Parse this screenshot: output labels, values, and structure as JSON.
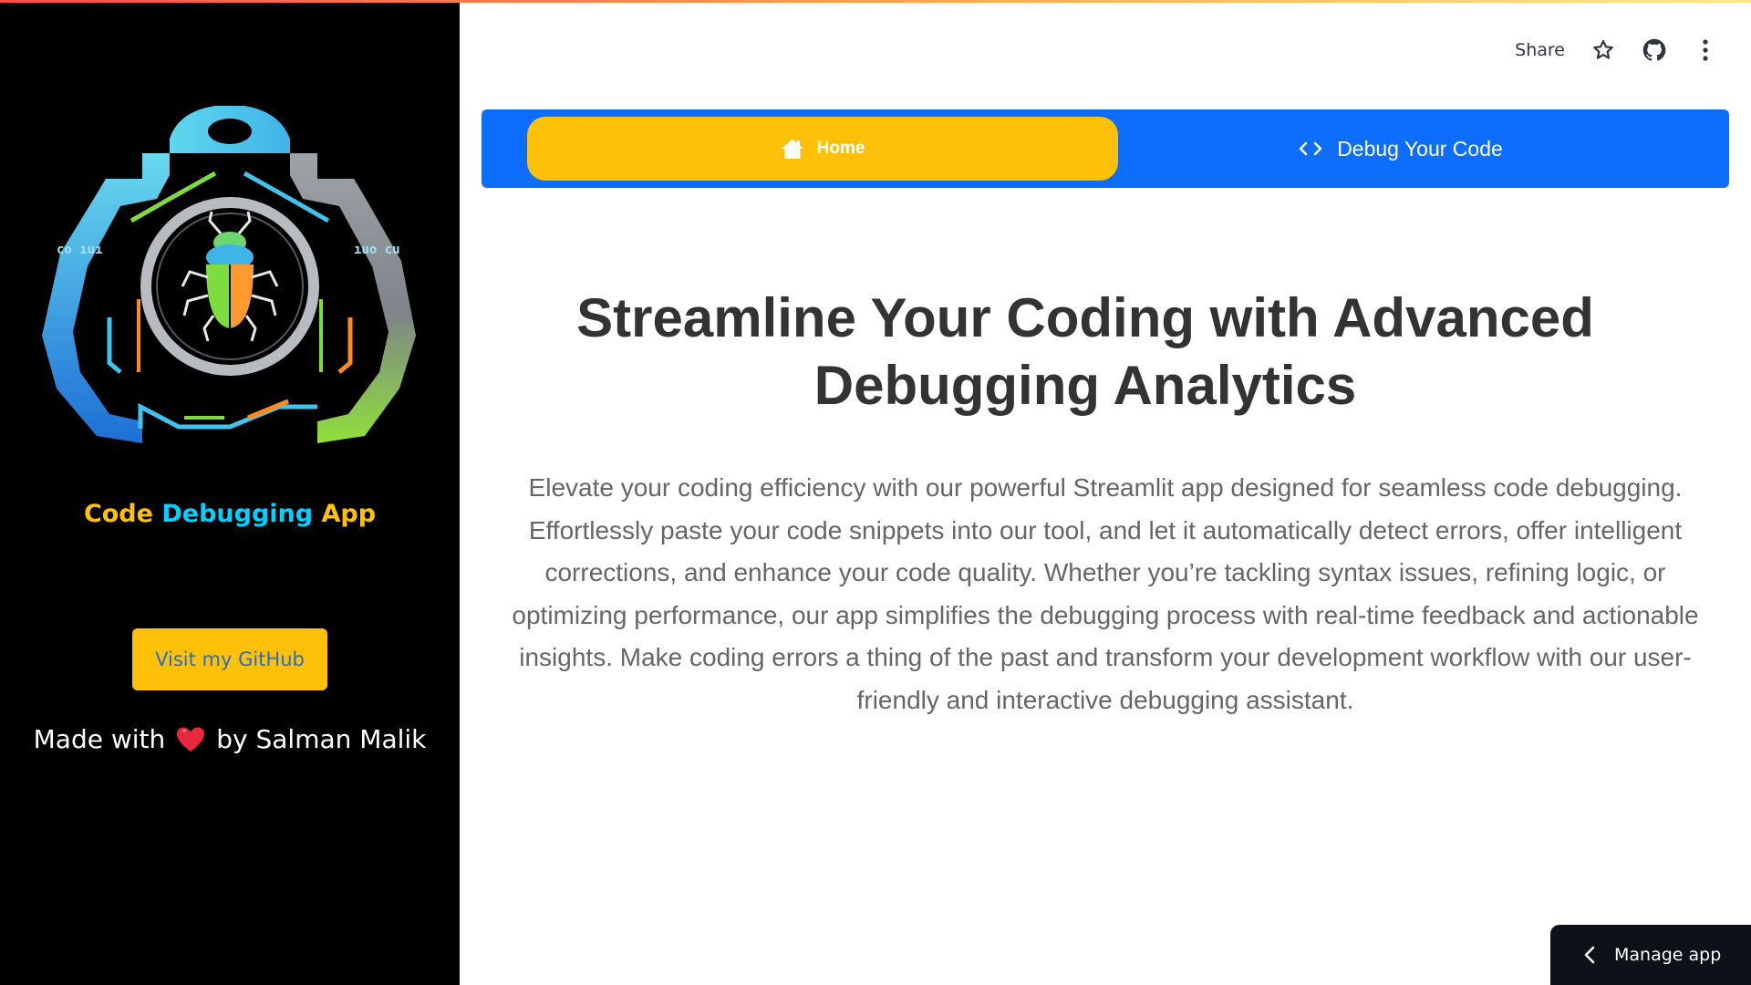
{
  "sidebar": {
    "title_part1": "Code",
    "title_part2": "Debugging",
    "title_part3": "App",
    "github_button": "Visit my GitHub",
    "made_with_prefix": "Made with",
    "made_with_suffix": "by Salman Malik",
    "logo_text_left": "co ıuı",
    "logo_text_right": "ıuo cu"
  },
  "toolbar": {
    "share_label": "Share"
  },
  "nav": {
    "home_label": "Home",
    "debug_label": "Debug Your Code"
  },
  "main": {
    "headline": "Streamline Your Coding with Advanced Debugging Analytics",
    "description": "Elevate your coding efficiency with our powerful Streamlit app designed for seamless code debugging. Effortlessly paste your code snippets into our tool, and let it automatically detect errors, offer intelligent corrections, and enhance your code quality. Whether you’re tackling syntax issues, refining logic, or optimizing performance, our app simplifies the debugging process with real-time feedback and actionable insights. Make coding errors a thing of the past and transform your development workflow with our user-friendly and interactive debugging assistant."
  },
  "footer": {
    "manage_app_label": "Manage app"
  },
  "colors": {
    "sidebar_bg": "#000000",
    "nav_bg": "#0d6efd",
    "accent_yellow": "#ffc107",
    "accent_cyan": "#00d1ff"
  }
}
